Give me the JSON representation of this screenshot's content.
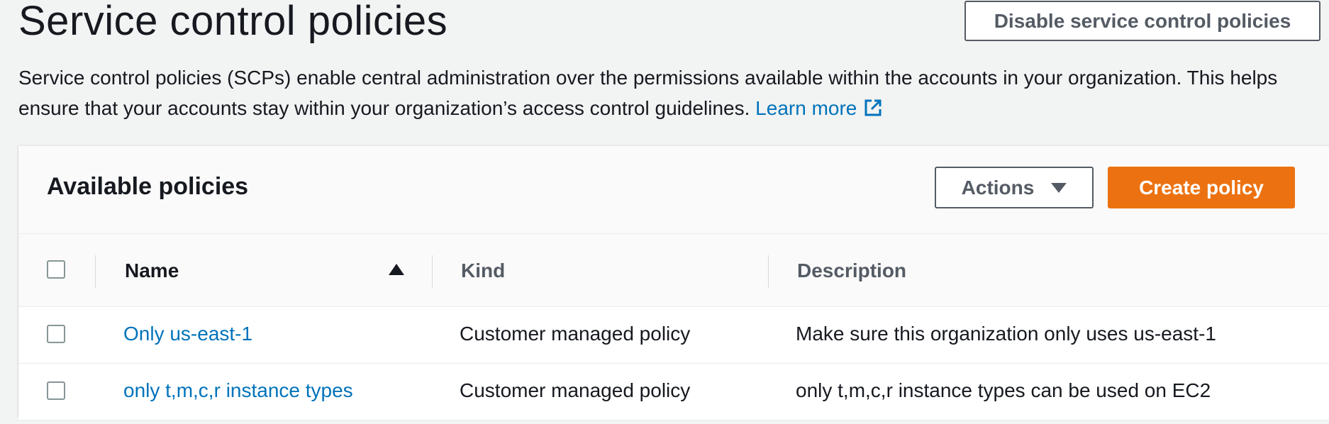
{
  "header": {
    "title": "Service control policies",
    "disable_button": "Disable service control policies"
  },
  "intro": {
    "text": "Service control policies (SCPs) enable central administration over the permissions available within the accounts in your organization. This helps ensure that your accounts stay within your organization’s access control guidelines.",
    "learn_more": "Learn more"
  },
  "panel": {
    "title": "Available policies",
    "actions_label": "Actions",
    "create_label": "Create policy"
  },
  "table": {
    "columns": [
      "Name",
      "Kind",
      "Description"
    ],
    "sort": {
      "column": "Name",
      "direction": "ascending"
    },
    "rows": [
      {
        "name": "Only us-east-1",
        "kind": "Customer managed policy",
        "description": "Make sure this organization only uses us-east-1"
      },
      {
        "name": "only t,m,c,r instance types",
        "kind": "Customer managed policy",
        "description": "only t,m,c,r instance types can be used on EC2"
      }
    ]
  },
  "colors": {
    "link": "#0073bb",
    "primary_button": "#ec7211",
    "text": "#16191f",
    "secondary_text": "#545b64",
    "background": "#f2f3f3"
  }
}
